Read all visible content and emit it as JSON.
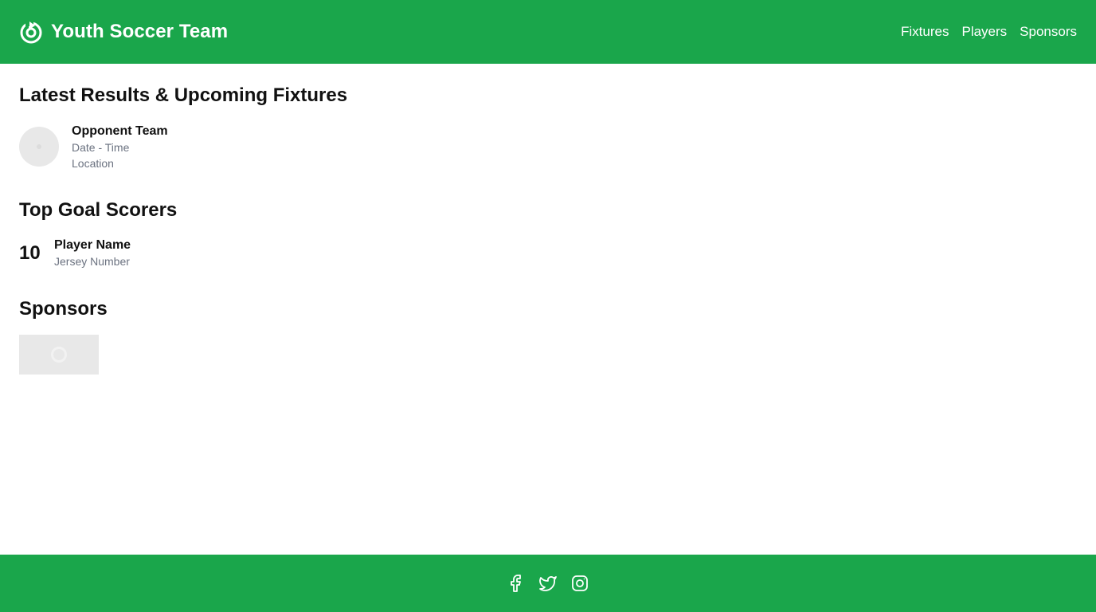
{
  "header": {
    "title": "Youth Soccer Team",
    "logo_icon": "soccer-logo-icon",
    "nav": [
      "Fixtures",
      "Players",
      "Sponsors"
    ]
  },
  "fixtures": {
    "title": "Latest Results & Upcoming Fixtures",
    "items": [
      {
        "opponent": "Opponent Team",
        "datetime": "Date - Time",
        "location": "Location"
      }
    ]
  },
  "scorers": {
    "title": "Top Goal Scorers",
    "items": [
      {
        "goals": "10",
        "name": "Player Name",
        "jersey": "Jersey Number"
      }
    ]
  },
  "sponsors": {
    "title": "Sponsors"
  },
  "footer": {
    "social_icons": [
      "facebook-icon",
      "twitter-icon",
      "instagram-icon"
    ]
  },
  "colors": {
    "brand_green": "#1aa64b",
    "placeholder_gray": "#e8e8e8",
    "muted_text": "#6b7280"
  }
}
